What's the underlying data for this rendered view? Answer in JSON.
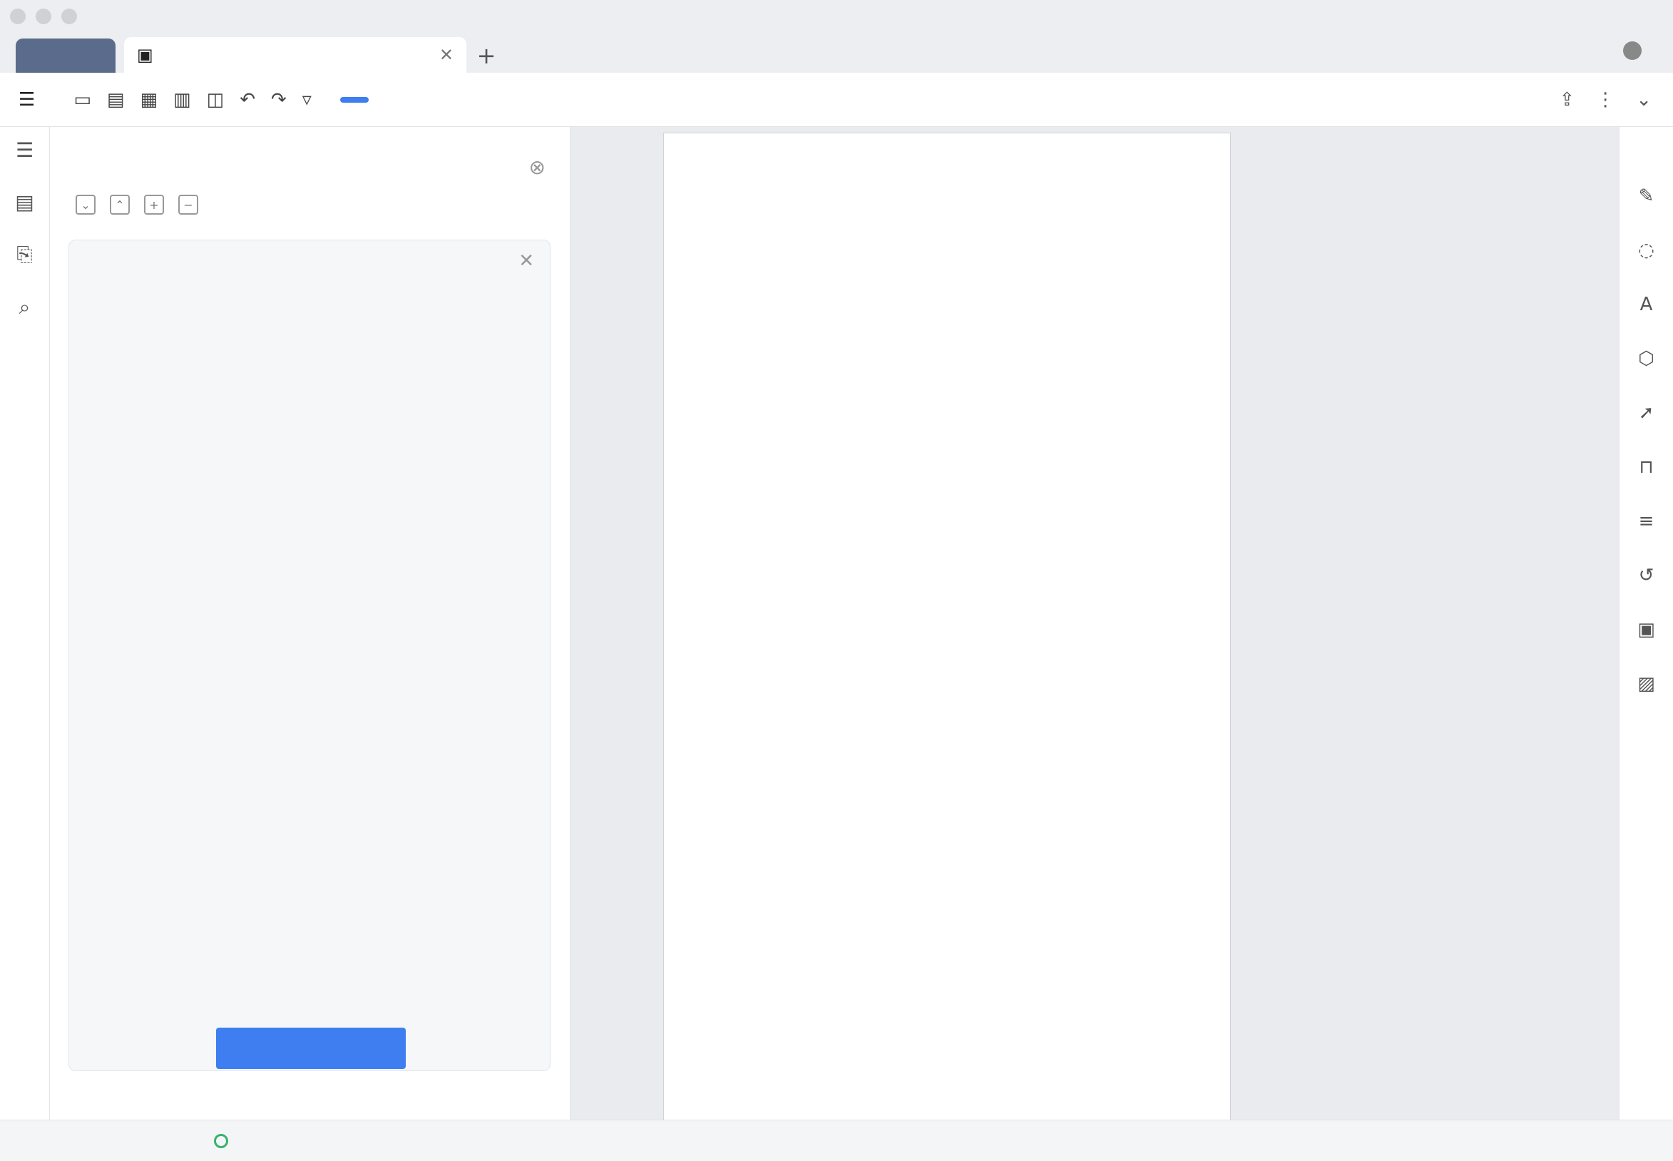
{
  "window": {
    "title": ""
  },
  "tabs": {
    "home_label": "",
    "doc_label": ""
  },
  "account": {
    "name": ""
  },
  "ribbon": {
    "file_label": "",
    "tabs": [
      {
        "label": "",
        "active": true
      },
      {
        "label": ""
      },
      {
        "label": ""
      },
      {
        "label": ""
      },
      {
        "label": ""
      },
      {
        "label": ""
      },
      {
        "label": ""
      },
      {
        "label": ""
      },
      {
        "label": ""
      }
    ]
  },
  "sidebar": {
    "title": "",
    "smart_outline_label": "",
    "ai_panel": {
      "line1": "",
      "line2": "",
      "button_label": ""
    },
    "outline": []
  },
  "document": {
    "paragraphs": []
  },
  "status": {
    "page_code": "",
    "page": "",
    "section": "",
    "row": "",
    "col": "",
    "word_count": "",
    "spell_check": "",
    "protection": ""
  }
}
